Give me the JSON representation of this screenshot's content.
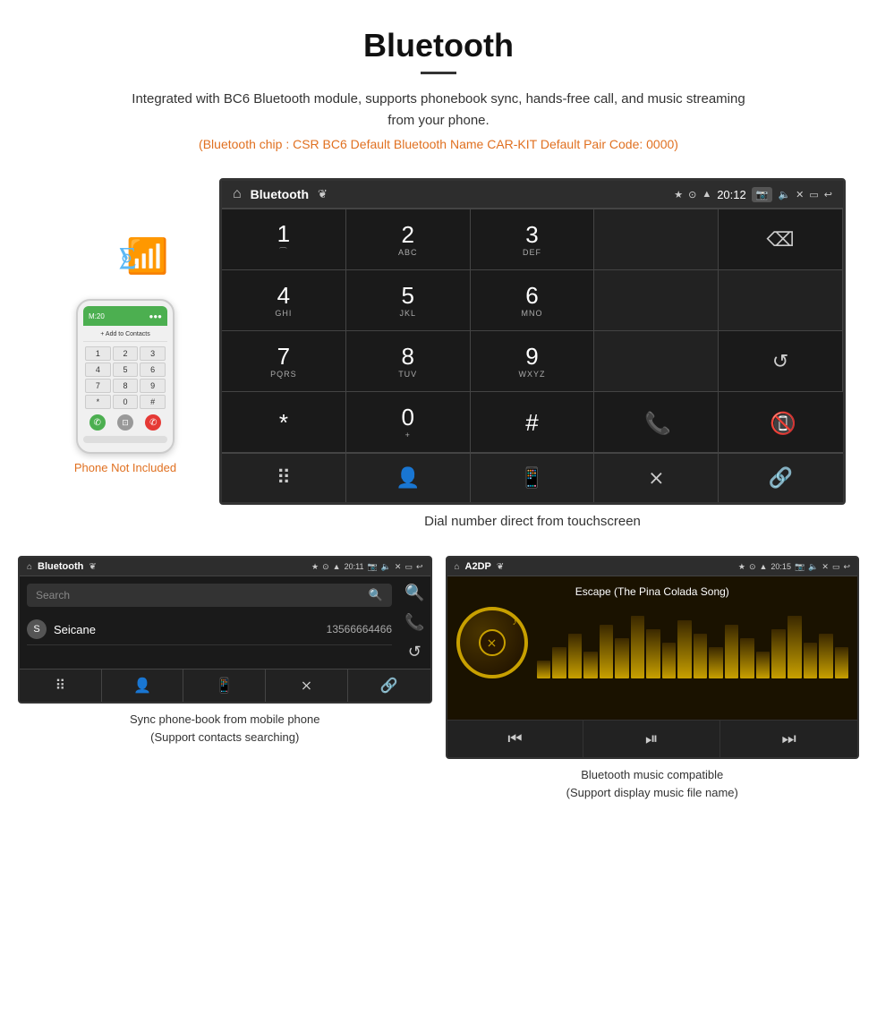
{
  "header": {
    "title": "Bluetooth",
    "description": "Integrated with BC6 Bluetooth module, supports phonebook sync, hands-free call, and music streaming from your phone.",
    "specs": "(Bluetooth chip : CSR BC6   Default Bluetooth Name CAR-KIT    Default Pair Code: 0000)"
  },
  "phone_label": "Phone Not Included",
  "large_screen": {
    "status": {
      "page_title": "Bluetooth",
      "time": "20:12"
    },
    "dialpad": [
      {
        "num": "1",
        "sub": ""
      },
      {
        "num": "2",
        "sub": "ABC"
      },
      {
        "num": "3",
        "sub": "DEF"
      },
      {
        "num": "",
        "sub": ""
      },
      {
        "num": "⌫",
        "sub": ""
      },
      {
        "num": "4",
        "sub": "GHI"
      },
      {
        "num": "5",
        "sub": "JKL"
      },
      {
        "num": "6",
        "sub": "MNO"
      },
      {
        "num": "",
        "sub": ""
      },
      {
        "num": "",
        "sub": ""
      },
      {
        "num": "7",
        "sub": "PQRS"
      },
      {
        "num": "8",
        "sub": "TUV"
      },
      {
        "num": "9",
        "sub": "WXYZ"
      },
      {
        "num": "",
        "sub": ""
      },
      {
        "num": "↺",
        "sub": ""
      },
      {
        "num": "*",
        "sub": ""
      },
      {
        "num": "0",
        "sub": "+"
      },
      {
        "num": "#",
        "sub": ""
      },
      {
        "num": "📞",
        "sub": ""
      },
      {
        "num": "📵",
        "sub": ""
      }
    ],
    "caption": "Dial number direct from touchscreen"
  },
  "phonebook_screen": {
    "status": {
      "page_title": "Bluetooth",
      "time": "20:11"
    },
    "search_placeholder": "Search",
    "contacts": [
      {
        "letter": "S",
        "name": "Seicane",
        "number": "13566664466"
      }
    ],
    "caption_line1": "Sync phone-book from mobile phone",
    "caption_line2": "(Support contacts searching)"
  },
  "music_screen": {
    "status": {
      "page_title": "A2DP",
      "time": "20:15"
    },
    "song_title": "Escape (The Pina Colada Song)",
    "viz_bars": [
      20,
      35,
      50,
      30,
      60,
      45,
      70,
      55,
      40,
      65,
      50,
      35,
      60,
      45,
      30,
      55,
      70,
      40,
      50,
      35
    ],
    "caption_line1": "Bluetooth music compatible",
    "caption_line2": "(Support display music file name)"
  }
}
